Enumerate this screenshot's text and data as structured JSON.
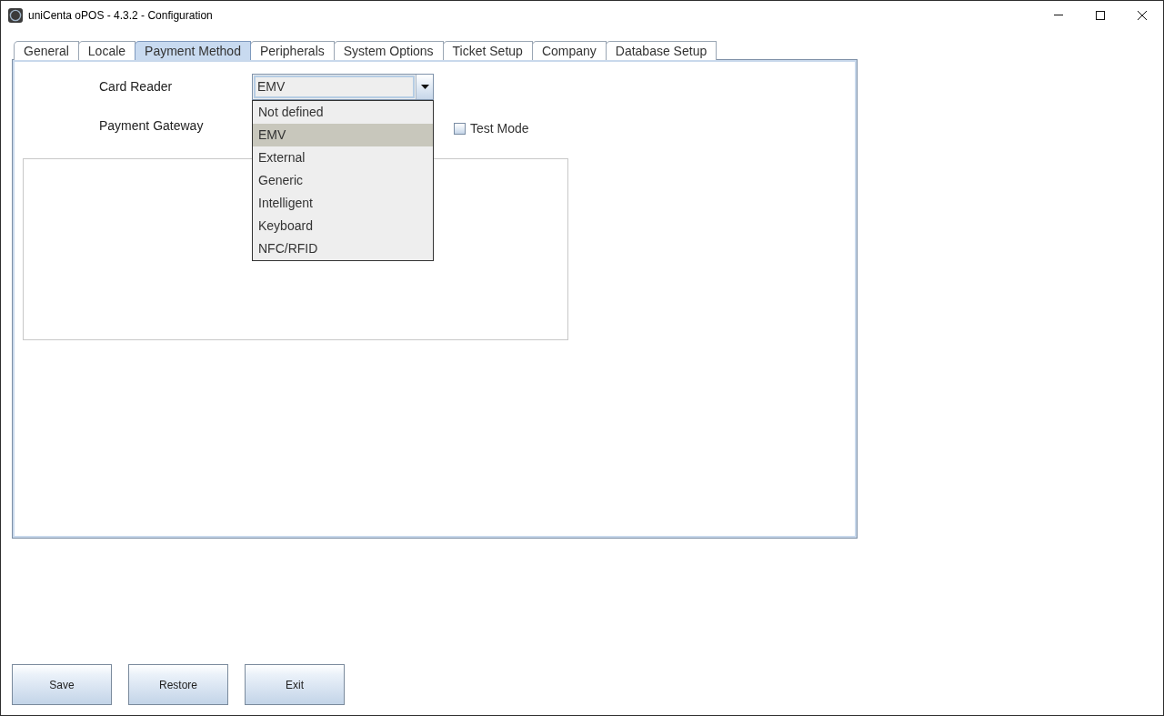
{
  "window": {
    "title": "uniCenta oPOS - 4.3.2 - Configuration"
  },
  "tabs": [
    {
      "label": "General",
      "selected": false
    },
    {
      "label": "Locale",
      "selected": false
    },
    {
      "label": "Payment Method",
      "selected": true
    },
    {
      "label": "Peripherals",
      "selected": false
    },
    {
      "label": "System Options",
      "selected": false
    },
    {
      "label": "Ticket Setup",
      "selected": false
    },
    {
      "label": "Company",
      "selected": false
    },
    {
      "label": "Database Setup",
      "selected": false
    }
  ],
  "payment_method": {
    "card_reader": {
      "label": "Card Reader",
      "value": "EMV",
      "expanded": true,
      "options": [
        {
          "label": "Not defined",
          "selected": false
        },
        {
          "label": "EMV",
          "selected": true
        },
        {
          "label": "External",
          "selected": false
        },
        {
          "label": "Generic",
          "selected": false
        },
        {
          "label": "Intelligent",
          "selected": false
        },
        {
          "label": "Keyboard",
          "selected": false
        },
        {
          "label": "NFC/RFID",
          "selected": false
        }
      ]
    },
    "payment_gateway": {
      "label": "Payment Gateway"
    },
    "test_mode": {
      "label": "Test Mode",
      "checked": false
    }
  },
  "buttons": [
    {
      "label": "Save"
    },
    {
      "label": "Restore"
    },
    {
      "label": "Exit"
    }
  ]
}
